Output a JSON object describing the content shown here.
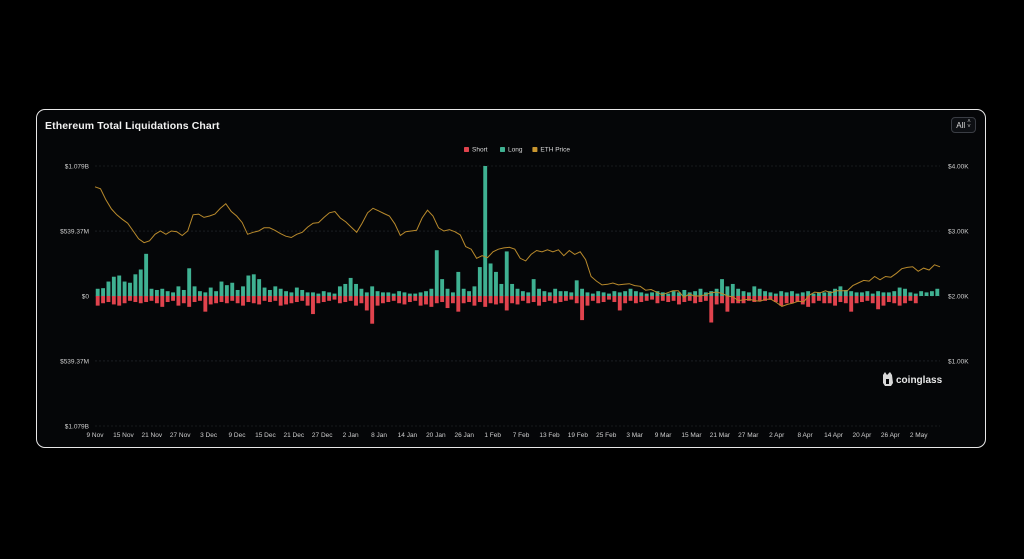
{
  "title": "Ethereum Total Liquidations Chart",
  "range_select": {
    "value": "All"
  },
  "watermark": "coinglass",
  "colors": {
    "short": "#e0434d",
    "long": "#3fb192",
    "price": "#b98a2c",
    "grid": "#2a2d33"
  },
  "chart_data": {
    "type": "bar",
    "legend": [
      {
        "name": "Short",
        "color": "#e0434d"
      },
      {
        "name": "Long",
        "color": "#3fb192"
      },
      {
        "name": "ETH Price",
        "color": "#c9962f"
      }
    ],
    "legend_position": "top-center",
    "grid": true,
    "y_left_ticks": [
      "$1.079B",
      "$539.37M",
      "$0",
      "$539.37M",
      "$1.079B"
    ],
    "y_left_values": [
      1079,
      539.37,
      0,
      -539.37,
      -1079
    ],
    "y_left_range_musd": [
      -1079,
      1079
    ],
    "y_right_ticks": [
      "$4.00K",
      "$3.00K",
      "$2.00K",
      "$1.00K"
    ],
    "y_right_values": [
      4000,
      3000,
      2000,
      1000
    ],
    "y_right_range_usd": [
      0,
      4000
    ],
    "x_ticks": [
      "9 Nov",
      "15 Nov",
      "21 Nov",
      "27 Nov",
      "3 Dec",
      "9 Dec",
      "15 Dec",
      "21 Dec",
      "27 Dec",
      "2 Jan",
      "8 Jan",
      "14 Jan",
      "20 Jan",
      "26 Jan",
      "1 Feb",
      "7 Feb",
      "13 Feb",
      "19 Feb",
      "25 Feb",
      "3 Mar",
      "9 Mar",
      "15 Mar",
      "21 Mar",
      "27 Mar",
      "2 Apr",
      "8 Apr",
      "14 Apr",
      "20 Apr",
      "26 Apr",
      "2 May"
    ],
    "series": [
      {
        "name": "Long",
        "values": [
          60,
          65,
          120,
          160,
          170,
          120,
          110,
          180,
          220,
          350,
          60,
          50,
          60,
          40,
          30,
          80,
          50,
          230,
          80,
          40,
          30,
          70,
          40,
          120,
          90,
          110,
          50,
          80,
          170,
          180,
          140,
          70,
          50,
          80,
          60,
          40,
          30,
          70,
          50,
          30,
          30,
          20,
          40,
          30,
          20,
          80,
          100,
          150,
          100,
          60,
          30,
          80,
          40,
          30,
          30,
          20,
          40,
          30,
          20,
          20,
          30,
          40,
          60,
          380,
          140,
          60,
          30,
          200,
          60,
          40,
          80,
          240,
          1079,
          270,
          200,
          100,
          370,
          100,
          60,
          40,
          30,
          140,
          60,
          40,
          30,
          60,
          40,
          40,
          30,
          130,
          60,
          30,
          20,
          40,
          30,
          20,
          40,
          30,
          40,
          60,
          40,
          30,
          20,
          30,
          40,
          30,
          20,
          40,
          30,
          50,
          30,
          40,
          60,
          30,
          40,
          60,
          140,
          80,
          100,
          60,
          40,
          30,
          80,
          60,
          40,
          30,
          20,
          40,
          30,
          40,
          20,
          30,
          40,
          20,
          30,
          30,
          40,
          60,
          80,
          50,
          40,
          30,
          30,
          40,
          20,
          40,
          30,
          30,
          40,
          70,
          60,
          30,
          20,
          40,
          30,
          40,
          60
        ]
      },
      {
        "name": "Short",
        "values": [
          80,
          60,
          50,
          70,
          80,
          60,
          40,
          50,
          60,
          50,
          40,
          60,
          90,
          50,
          40,
          80,
          60,
          90,
          50,
          40,
          130,
          70,
          60,
          50,
          60,
          40,
          60,
          80,
          50,
          60,
          70,
          40,
          50,
          40,
          80,
          70,
          60,
          50,
          40,
          80,
          150,
          60,
          50,
          40,
          30,
          60,
          50,
          40,
          80,
          60,
          120,
          230,
          80,
          60,
          50,
          40,
          60,
          70,
          50,
          40,
          80,
          70,
          90,
          60,
          50,
          100,
          60,
          130,
          60,
          50,
          80,
          50,
          90,
          60,
          70,
          60,
          120,
          60,
          70,
          40,
          60,
          50,
          80,
          50,
          40,
          60,
          50,
          40,
          30,
          60,
          200,
          80,
          40,
          60,
          50,
          30,
          50,
          120,
          60,
          40,
          60,
          50,
          40,
          30,
          60,
          40,
          50,
          40,
          70,
          50,
          40,
          60,
          50,
          40,
          220,
          70,
          60,
          130,
          60,
          60,
          60,
          40,
          50,
          40,
          40,
          30,
          50,
          80,
          60,
          60,
          50,
          70,
          90,
          60,
          40,
          60,
          60,
          80,
          50,
          60,
          130,
          60,
          50,
          40,
          60,
          110,
          80,
          50,
          60,
          80,
          60,
          40,
          60
        ]
      },
      {
        "name": "ETH Price",
        "values": [
          3680,
          3650,
          3480,
          3340,
          3250,
          3180,
          3120,
          3000,
          2880,
          2820,
          2850,
          2950,
          3000,
          2950,
          3000,
          2990,
          2930,
          3000,
          3250,
          3260,
          3210,
          3230,
          3260,
          3350,
          3420,
          3300,
          3230,
          3130,
          2950,
          2980,
          3000,
          3050,
          3050,
          3010,
          2960,
          2920,
          2900,
          2950,
          2980,
          3060,
          3120,
          3130,
          3210,
          3280,
          3300,
          3200,
          3140,
          3060,
          2980,
          3120,
          3280,
          3350,
          3310,
          3270,
          3230,
          3110,
          2930,
          2990,
          3000,
          3010,
          3200,
          3320,
          3230,
          3050,
          3000,
          3020,
          2990,
          2940,
          2760,
          2720,
          2580,
          2620,
          2590,
          2680,
          2720,
          2740,
          2750,
          2720,
          2580,
          2540,
          2640,
          2700,
          2680,
          2710,
          2680,
          2710,
          2620,
          2700,
          2640,
          2680,
          2560,
          2300,
          2230,
          2170,
          2180,
          2200,
          2170,
          2180,
          2190,
          2160,
          2150,
          2090,
          2100,
          2060,
          2020,
          2050,
          2080,
          2080,
          1980,
          2030,
          2000,
          2000,
          2020,
          2050,
          2060,
          2040,
          2000,
          1990,
          1930,
          1940,
          1950,
          1930,
          1920,
          1950,
          1950,
          1900,
          1840,
          1870,
          1890,
          1920,
          1910,
          2010,
          2060,
          2050,
          2080,
          2050,
          2080,
          2080,
          2080,
          2160,
          2200,
          2240,
          2230,
          2300,
          2250,
          2300,
          2290,
          2350,
          2420,
          2440,
          2450,
          2380,
          2430,
          2400,
          2480,
          2450
        ]
      }
    ]
  }
}
